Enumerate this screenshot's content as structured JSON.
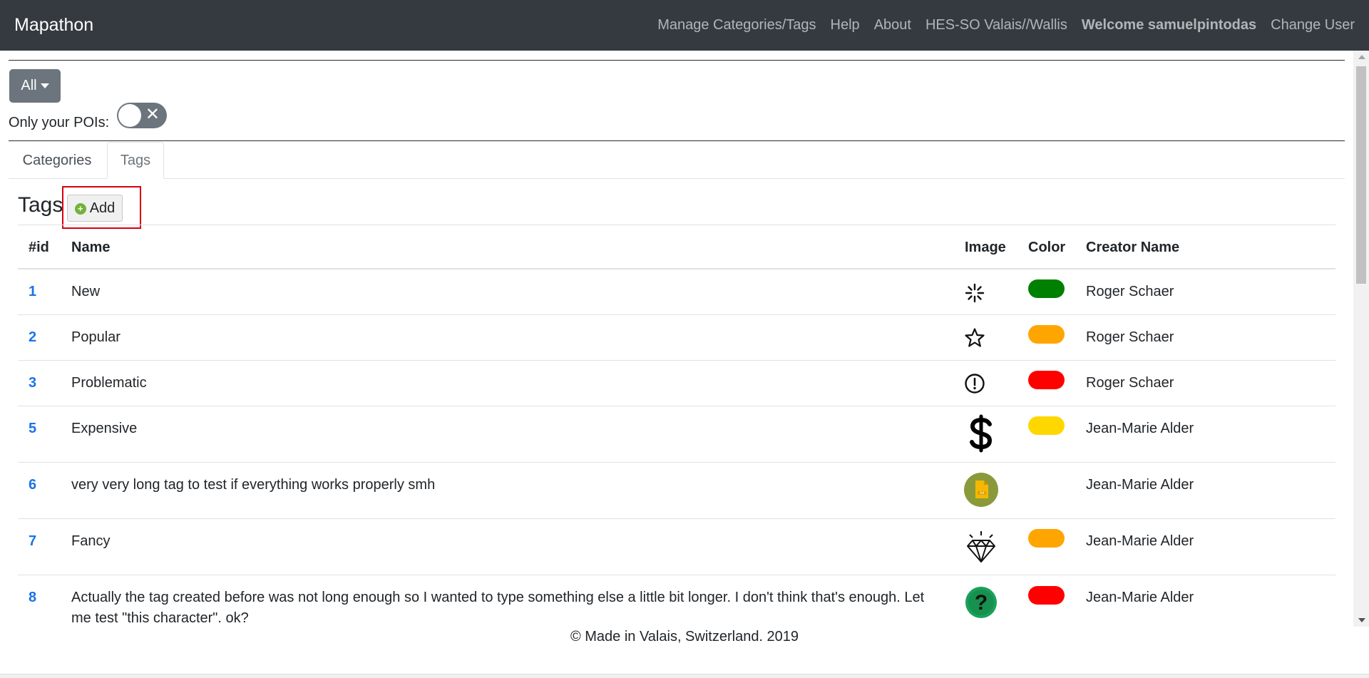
{
  "nav": {
    "brand": "Mapathon",
    "links": [
      "Manage Categories/Tags",
      "Help",
      "About",
      "HES-SO Valais//Wallis"
    ],
    "welcome": "Welcome samuelpintodas",
    "change_user": "Change User"
  },
  "filter": {
    "dropdown_label": "All",
    "only_poi_label": "Only your POIs:",
    "only_poi_enabled": false
  },
  "tabs": [
    {
      "label": "Categories",
      "active": false
    },
    {
      "label": "Tags",
      "active": true
    }
  ],
  "section": {
    "title": "Tags",
    "add_label": "Add"
  },
  "table": {
    "headers": {
      "id": "#id",
      "name": "Name",
      "image": "Image",
      "color": "Color",
      "creator": "Creator Name"
    },
    "rows": [
      {
        "id": "1",
        "name": "New",
        "icon": "sparkle-icon",
        "color": "#008000",
        "creator": "Roger Schaer"
      },
      {
        "id": "2",
        "name": "Popular",
        "icon": "star-icon",
        "color": "#ffa500",
        "creator": "Roger Schaer"
      },
      {
        "id": "3",
        "name": "Problematic",
        "icon": "exclamation-circle-icon",
        "color": "#ff0000",
        "creator": "Roger Schaer"
      },
      {
        "id": "5",
        "name": "Expensive",
        "icon": "dollar-icon",
        "color": "#ffd700",
        "creator": "Jean-Marie Alder"
      },
      {
        "id": "6",
        "name": "very very long tag to test if everything works properly smh",
        "icon": "txt-file-icon",
        "color": "",
        "creator": "Jean-Marie Alder"
      },
      {
        "id": "7",
        "name": "Fancy",
        "icon": "diamond-icon",
        "color": "#ffa500",
        "creator": "Jean-Marie Alder"
      },
      {
        "id": "8",
        "name": "Actually the tag created before was not long enough so I wanted to type something else a little bit longer. I don't think that's enough. Let me test \"this character\". ok?",
        "icon": "question-circle-icon",
        "color": "#ff0000",
        "creator": "Jean-Marie Alder"
      }
    ]
  },
  "footer": "© Made in Valais, Switzerland. 2019"
}
